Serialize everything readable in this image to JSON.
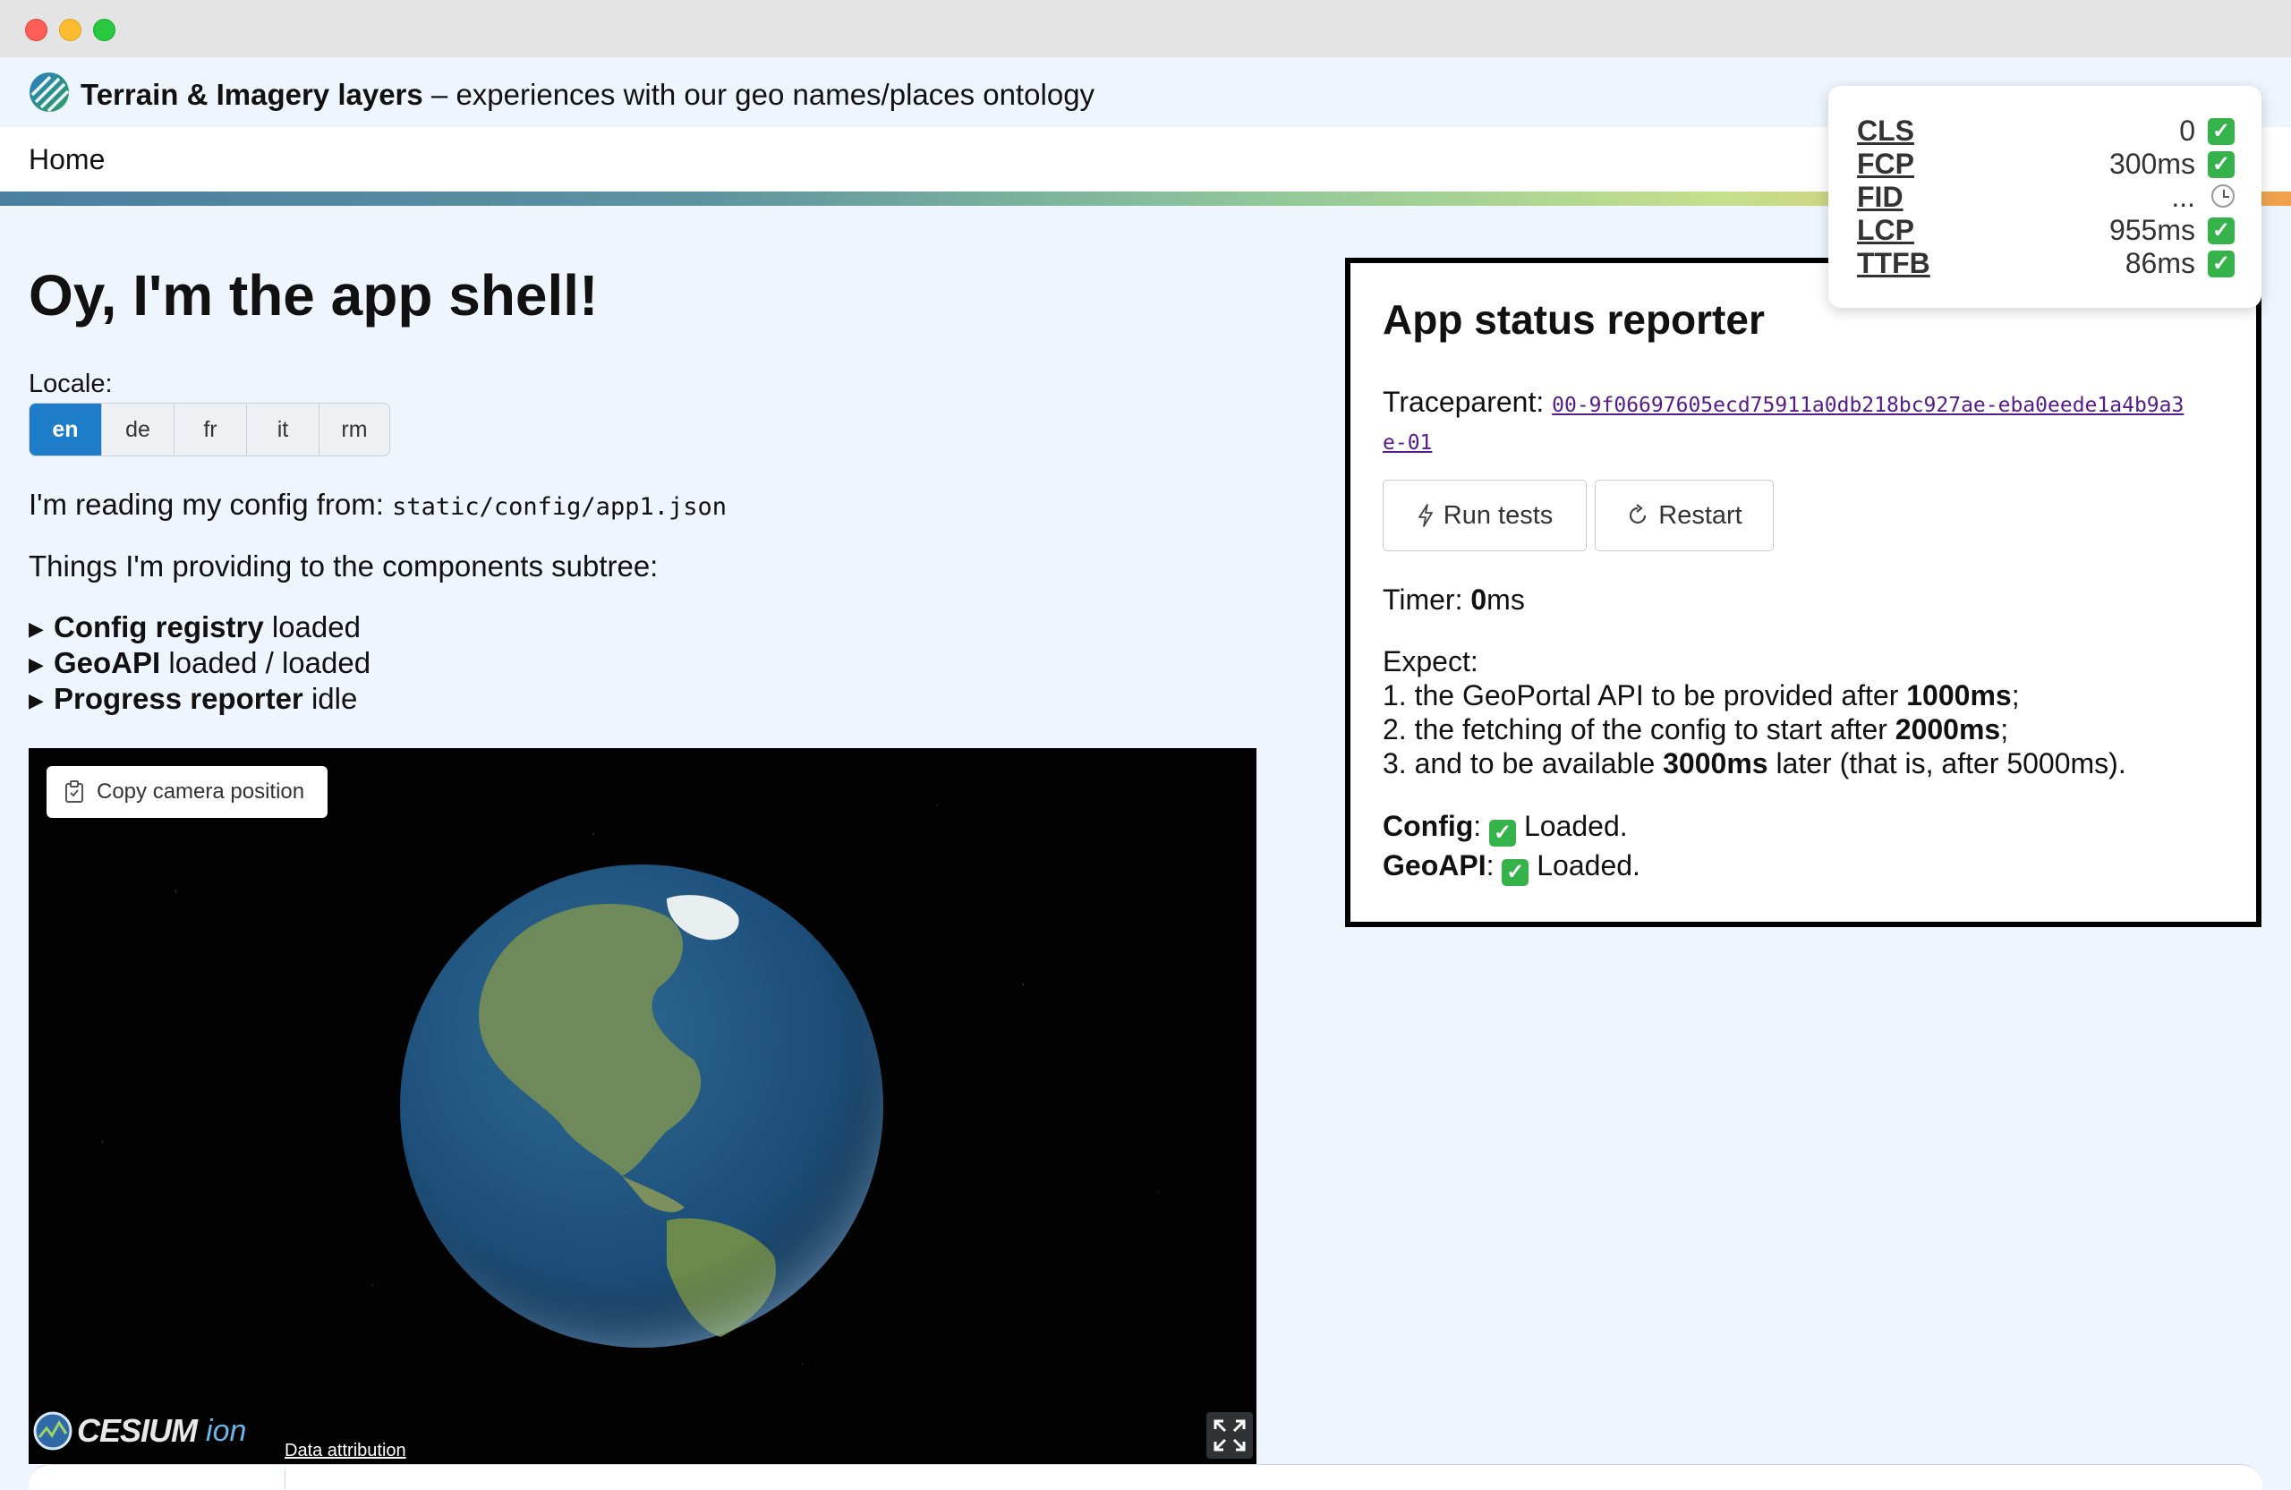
{
  "header": {
    "title_bold": "Terrain & Imagery layers",
    "title_rest": " – experiences with our geo names/places ontology"
  },
  "nav": {
    "home": "Home"
  },
  "main": {
    "heading": "Oy, I'm the app shell!",
    "locale_label": "Locale:",
    "locales": [
      "en",
      "de",
      "fr",
      "it",
      "rm"
    ],
    "active_locale": "en",
    "config_prefix": "I'm reading my config from: ",
    "config_path": "static/config/app1.json",
    "providing": "Things I'm providing to the components subtree:",
    "tree": [
      {
        "label": "Config registry",
        "status": " loaded"
      },
      {
        "label": "GeoAPI",
        "status": " loaded / loaded"
      },
      {
        "label": "Progress reporter",
        "status": " idle"
      }
    ]
  },
  "viewer": {
    "copy_camera": "Copy camera position",
    "logo_word": "CESIUM",
    "logo_ion": "ion",
    "attribution": "Data attribution"
  },
  "status_panel": {
    "title": "App status reporter",
    "traceparent_label": "Traceparent: ",
    "traceparent_value": "00-9f06697605ecd75911a0db218bc927ae-eba0eede1a4b9a3e-01",
    "run_tests": "Run tests",
    "restart": "Restart",
    "timer_label": "Timer: ",
    "timer_value": "0",
    "timer_unit": "ms",
    "expect_label": "Expect:",
    "expect": [
      {
        "pre": "1. the GeoPortal API to be provided after ",
        "bold": "1000ms",
        "post": ";"
      },
      {
        "pre": "2. the fetching of the config to start after ",
        "bold": "2000ms",
        "post": ";"
      },
      {
        "pre": "3. and to be available ",
        "bold": "3000ms",
        "post": " later (that is, after 5000ms)."
      }
    ],
    "config_label": "Config",
    "config_status": "Loaded.",
    "geoapi_label": "GeoAPI",
    "geoapi_status": "Loaded."
  },
  "vitals": [
    {
      "name": "CLS",
      "value": "0",
      "state": "good"
    },
    {
      "name": "FCP",
      "value": "300ms",
      "state": "good"
    },
    {
      "name": "FID",
      "value": "...",
      "state": "pending"
    },
    {
      "name": "LCP",
      "value": "955ms",
      "state": "good"
    },
    {
      "name": "TTFB",
      "value": "86ms",
      "state": "good"
    }
  ],
  "colors": {
    "accent": "#1e7dc8",
    "page_bg": "#eef5fd",
    "check_green": "#36b24a"
  }
}
